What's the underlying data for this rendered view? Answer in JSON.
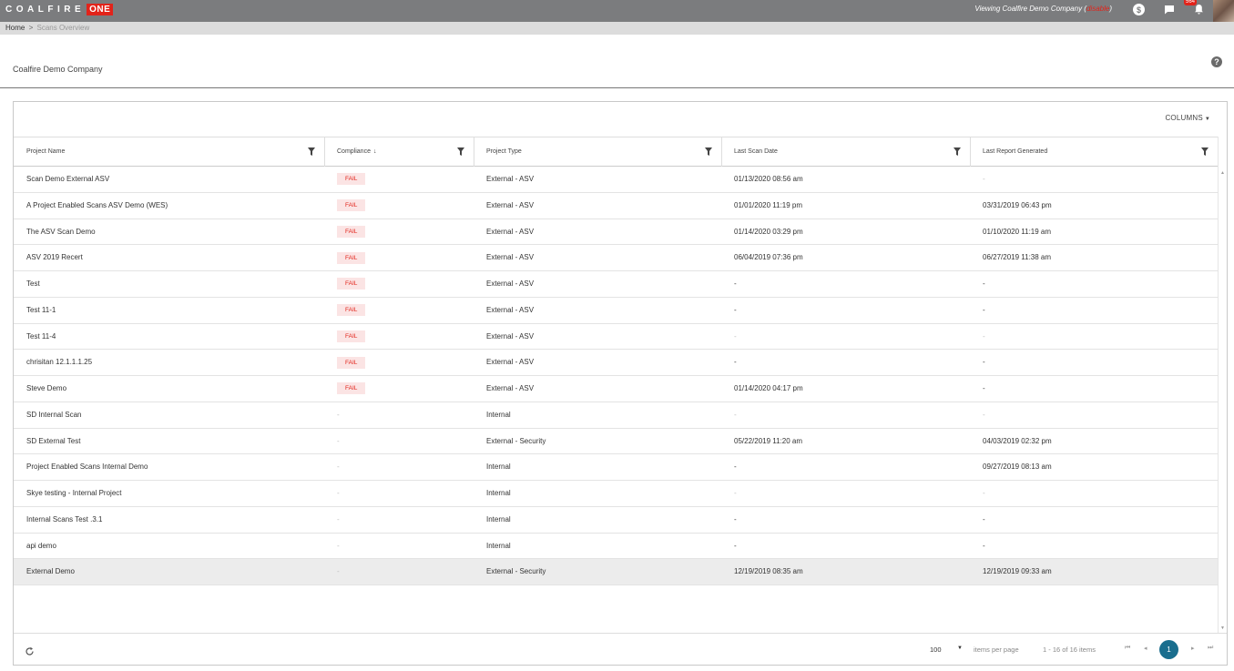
{
  "topbar": {
    "logo_text": "COALFIRE",
    "logo_badge": "ONE",
    "viewing_prefix": "Viewing Coalfire Demo Company (",
    "viewing_link": "disable",
    "viewing_suffix": ")",
    "notification_count": "564",
    "icons": [
      "dollar-icon",
      "chat-icon",
      "bell-icon",
      "avatar"
    ]
  },
  "breadcrumb": {
    "home": "Home",
    "separator": ">",
    "current": "Scans Overview"
  },
  "page": {
    "title": "Coalfire Demo Company",
    "help": "?"
  },
  "grid": {
    "columns_button": "COLUMNS",
    "headers": [
      {
        "label": "Project Name",
        "sort": ""
      },
      {
        "label": "Compliance",
        "sort": "↓"
      },
      {
        "label": "Project Type",
        "sort": ""
      },
      {
        "label": "Last Scan Date",
        "sort": ""
      },
      {
        "label": "Last Report Generated",
        "sort": ""
      }
    ],
    "rows": [
      {
        "name": "Scan Demo External ASV",
        "compliance": "FAIL",
        "type": "External - ASV",
        "last_scan": "01/13/2020 08:56 am",
        "last_report": "-"
      },
      {
        "name": "A Project Enabled Scans ASV Demo (WES)",
        "compliance": "FAIL",
        "type": "External - ASV",
        "last_scan": "01/01/2020 11:19 pm",
        "last_report": "03/31/2019 06:43 pm"
      },
      {
        "name": "The ASV Scan Demo",
        "compliance": "FAIL",
        "type": "External - ASV",
        "last_scan": "01/14/2020 03:29 pm",
        "last_report": "01/10/2020 11:19 am"
      },
      {
        "name": "ASV 2019 Recert",
        "compliance": "FAIL",
        "type": "External - ASV",
        "last_scan": "06/04/2019 07:36 pm",
        "last_report": "06/27/2019 11:38 am"
      },
      {
        "name": "Test",
        "compliance": "FAIL",
        "type": "External - ASV",
        "last_scan": "-",
        "last_report": "-"
      },
      {
        "name": "Test 11-1",
        "compliance": "FAIL",
        "type": "External - ASV",
        "last_scan": "-",
        "last_report": "-"
      },
      {
        "name": "Test 11-4",
        "compliance": "FAIL",
        "type": "External - ASV",
        "last_scan": "-",
        "last_report": "-"
      },
      {
        "name": "chrisitan 12.1.1.1.25",
        "compliance": "FAIL",
        "type": "External - ASV",
        "last_scan": "-",
        "last_report": "-"
      },
      {
        "name": "Steve Demo",
        "compliance": "FAIL",
        "type": "External - ASV",
        "last_scan": "01/14/2020 04:17 pm",
        "last_report": "-"
      },
      {
        "name": "SD Internal Scan",
        "compliance": "-",
        "type": "Internal",
        "last_scan": "-",
        "last_report": "-"
      },
      {
        "name": "SD External Test",
        "compliance": "-",
        "type": "External - Security",
        "last_scan": "05/22/2019 11:20 am",
        "last_report": "04/03/2019 02:32 pm"
      },
      {
        "name": "Project Enabled Scans Internal Demo",
        "compliance": "-",
        "type": "Internal",
        "last_scan": "-",
        "last_report": "09/27/2019 08:13 am"
      },
      {
        "name": "Skye testing - Internal Project",
        "compliance": "-",
        "type": "Internal",
        "last_scan": "-",
        "last_report": "-"
      },
      {
        "name": "Internal Scans Test .3.1",
        "compliance": "-",
        "type": "Internal",
        "last_scan": "-",
        "last_report": "-"
      },
      {
        "name": "api demo",
        "compliance": "-",
        "type": "Internal",
        "last_scan": "-",
        "last_report": "-"
      },
      {
        "name": "External Demo",
        "compliance": "-",
        "type": "External - Security",
        "last_scan": "12/19/2019 08:35 am",
        "last_report": "12/19/2019 09:33 am"
      }
    ],
    "selected_row": 15
  },
  "pager": {
    "per_page": "100",
    "per_page_label": "items per page",
    "items_info": "1 - 16 of 16 items",
    "current_page": "1",
    "nav": {
      "first": "⏮",
      "prev": "◂",
      "next": "▸",
      "last": "⏭"
    }
  },
  "colors": {
    "topbar": "#7b7c7e",
    "brand_red": "#e2231a",
    "fail_bg": "#fbe4e4",
    "page_active": "#1a6e8e"
  }
}
